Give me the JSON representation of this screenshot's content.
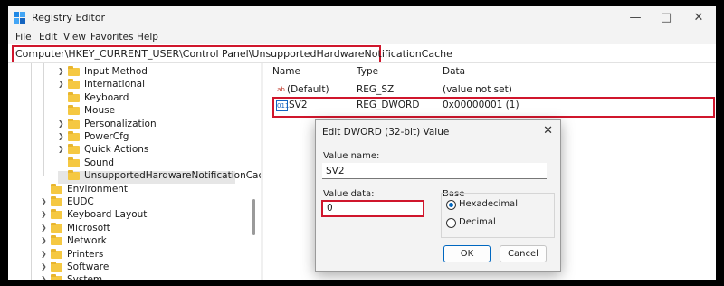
{
  "window": {
    "title": "Registry Editor",
    "minimize_icon": "minimize-icon",
    "maximize_icon": "maximize-icon",
    "close_icon": "close-icon"
  },
  "menu": [
    "File",
    "Edit",
    "View",
    "Favorites",
    "Help"
  ],
  "address": "Computer\\HKEY_CURRENT_USER\\Control Panel\\UnsupportedHardwareNotificationCache",
  "tree": {
    "items": [
      {
        "label": "Input Method",
        "expandable": true
      },
      {
        "label": "International",
        "expandable": true
      },
      {
        "label": "Keyboard",
        "expandable": false
      },
      {
        "label": "Mouse",
        "expandable": false
      },
      {
        "label": "Personalization",
        "expandable": true
      },
      {
        "label": "PowerCfg",
        "expandable": true
      },
      {
        "label": "Quick Actions",
        "expandable": true
      },
      {
        "label": "Sound",
        "expandable": false
      },
      {
        "label": "UnsupportedHardwareNotificationCache",
        "expandable": false,
        "selected": true
      },
      {
        "label": "Environment",
        "expandable": false
      },
      {
        "label": "EUDC",
        "expandable": true
      },
      {
        "label": "Keyboard Layout",
        "expandable": true
      },
      {
        "label": "Microsoft",
        "expandable": true
      },
      {
        "label": "Network",
        "expandable": true
      },
      {
        "label": "Printers",
        "expandable": true
      },
      {
        "label": "Software",
        "expandable": true
      },
      {
        "label": "System",
        "expandable": true
      }
    ]
  },
  "values_pane": {
    "columns": [
      "Name",
      "Type",
      "Data"
    ],
    "rows": [
      {
        "name": "(Default)",
        "type": "REG_SZ",
        "data": "(value not set)",
        "icon": "ab"
      },
      {
        "name": "SV2",
        "type": "REG_DWORD",
        "data": "0x00000001 (1)",
        "icon": "011"
      }
    ]
  },
  "dialog": {
    "title": "Edit DWORD (32-bit) Value",
    "value_name_label": "Value name:",
    "value_name": "SV2",
    "value_data_label": "Value data:",
    "value_data": "0",
    "base_label": "Base",
    "hex_label": "Hexadecimal",
    "dec_label": "Decimal",
    "ok": "OK",
    "cancel": "Cancel"
  },
  "colors": {
    "highlight": "#d0162c",
    "accent": "#0067c0"
  }
}
